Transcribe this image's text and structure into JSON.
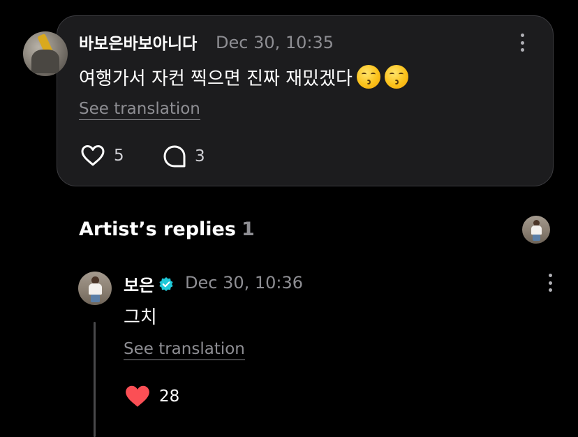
{
  "comment": {
    "username": "바보은바보아니다",
    "timestamp": "Dec 30, 10:35",
    "text": "여행가서 자컨 찍으면 진짜 재밌겠다",
    "emoji_names": [
      "kissing-face-icon",
      "kissing-face-icon"
    ],
    "see_translation": "See translation",
    "like_count": "5",
    "reply_count": "3"
  },
  "artist_replies": {
    "title": "Artist’s replies",
    "count": "1"
  },
  "reply": {
    "username": "보은",
    "verified": true,
    "timestamp": "Dec 30, 10:36",
    "text": "그치",
    "see_translation": "See translation",
    "like_count": "28",
    "liked": true
  },
  "colors": {
    "background": "#000000",
    "card": "#1c1c1e",
    "card_border": "#3c3c40",
    "secondary_text": "#8e8e93",
    "verified_badge": "#1fc8d8",
    "heart_liked": "#fb4f55"
  }
}
